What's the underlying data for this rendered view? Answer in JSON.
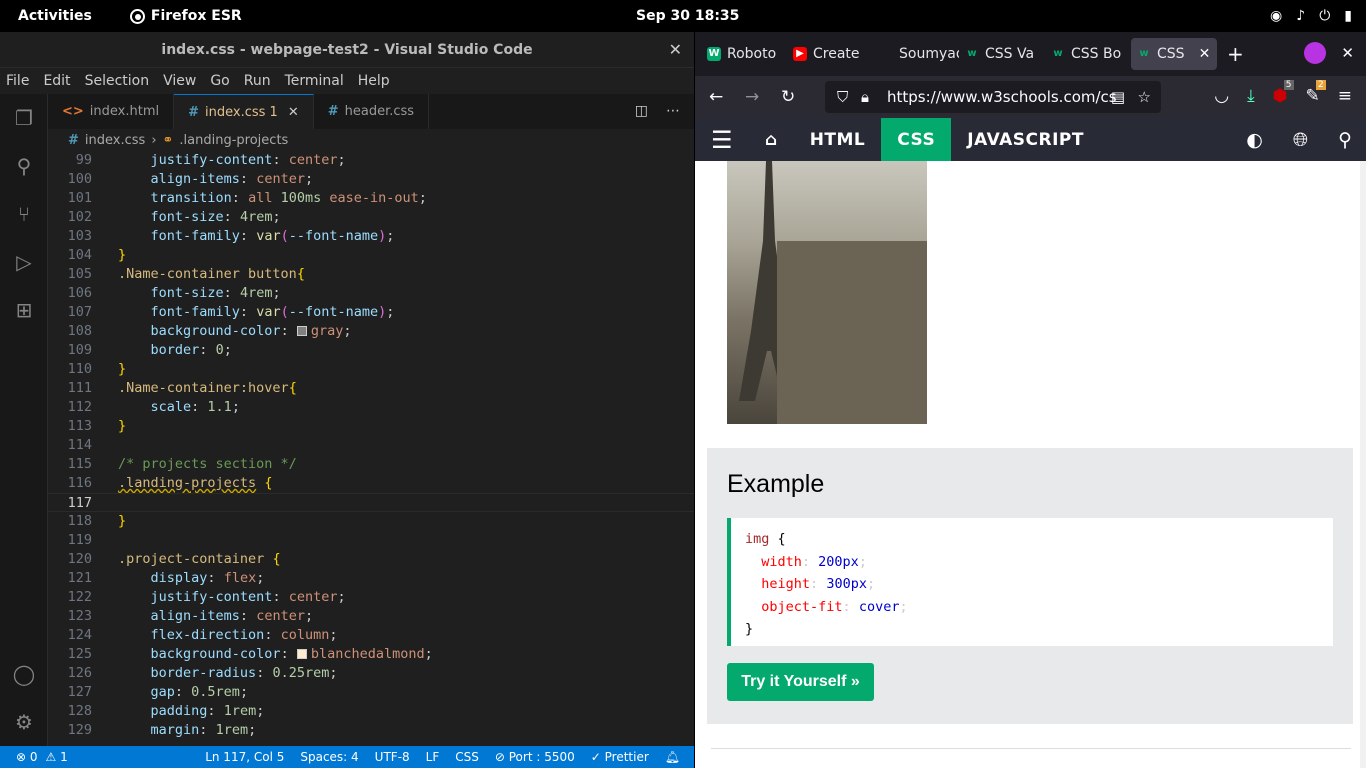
{
  "topbar": {
    "activities": "Activities",
    "app_name": "Firefox ESR",
    "clock": "Sep 30  18:35"
  },
  "vscode": {
    "title": "index.css - webpage-test2 - Visual Studio Code",
    "menu": [
      "File",
      "Edit",
      "Selection",
      "View",
      "Go",
      "Run",
      "Terminal",
      "Help"
    ],
    "tabs": [
      {
        "label": "index.html",
        "icon": "html-file-icon"
      },
      {
        "label": "index.css 1",
        "icon": "css-file-icon"
      },
      {
        "label": "header.css",
        "icon": "css-file-icon"
      }
    ],
    "breadcrumb": {
      "file": "index.css",
      "symbol": ".landing-projects"
    },
    "line_numbers": [
      "99",
      "100",
      "101",
      "102",
      "103",
      "104",
      "105",
      "106",
      "107",
      "108",
      "109",
      "110",
      "111",
      "112",
      "113",
      "114",
      "115",
      "116",
      "117",
      "118",
      "119",
      "120",
      "121",
      "122",
      "123",
      "124",
      "125",
      "126",
      "127",
      "128",
      "129"
    ],
    "code": {
      "l99_p": "justify-content",
      "l99_v": "center",
      "l100_p": "align-items",
      "l100_v": "center",
      "l101_p": "transition",
      "l101_v1": "all",
      "l101_n": "100ms",
      "l101_v2": "ease-in-out",
      "l102_p": "font-size",
      "l102_n": "4rem",
      "l103_p": "font-family",
      "l103_f": "var",
      "l103_arg": "--font-name",
      "l105_s": ".Name-container button",
      "l106_p": "font-size",
      "l106_n": "4rem",
      "l107_p": "font-family",
      "l107_f": "var",
      "l107_arg": "--font-name",
      "l108_p": "background-color",
      "l108_v": "gray",
      "l109_p": "border",
      "l109_n": "0",
      "l111_s": ".Name-container:hover",
      "l112_p": "scale",
      "l112_n": "1.1",
      "l115_c": "/* projects section */",
      "l116_s": ".landing-projects",
      "l120_s": ".project-container",
      "l121_p": "display",
      "l121_v": "flex",
      "l122_p": "justify-content",
      "l122_v": "center",
      "l123_p": "align-items",
      "l123_v": "center",
      "l124_p": "flex-direction",
      "l124_v": "column",
      "l125_p": "background-color",
      "l125_v": "blanchedalmond",
      "l126_p": "border-radius",
      "l126_n": "0.25rem",
      "l127_p": "gap",
      "l127_n": "0.5rem",
      "l128_p": "padding",
      "l128_n": "1rem",
      "l129_p": "margin",
      "l129_n": "1rem"
    },
    "status": {
      "errors": "⊗ 0",
      "warnings": "⚠ 1",
      "position": "Ln 117, Col 5",
      "spaces": "Spaces: 4",
      "encoding": "UTF-8",
      "eol": "LF",
      "language": "CSS",
      "port": "⊘ Port : 5500",
      "prettier": "✓ Prettier"
    },
    "colors": {
      "gray": "#808080",
      "blanchedalmond": "#ffebcd",
      "accent": "#0078d4"
    }
  },
  "firefox": {
    "tabs": [
      {
        "label": "Roboto",
        "favicon": "W3",
        "color": "#04aa6d"
      },
      {
        "label": "Create",
        "favicon": "▶",
        "color": "#ff0000"
      },
      {
        "label": "Soumyade",
        "favicon": "",
        "color": "#1c1b22"
      },
      {
        "label": "CSS Va",
        "favicon": "w",
        "color": "#04aa6d"
      },
      {
        "label": "CSS Bo",
        "favicon": "w",
        "color": "#04aa6d"
      },
      {
        "label": "CSS",
        "favicon": "w",
        "color": "#04aa6d"
      }
    ],
    "url": "https://www.w3schools.com/cs",
    "badges": {
      "ublock": "5",
      "ext": "2"
    }
  },
  "w3": {
    "nav": [
      "HTML",
      "CSS",
      "JAVASCRIPT"
    ],
    "example_heading": "Example",
    "code": {
      "selector": "img",
      "open": "{",
      "p1": "width",
      "v1": "200px",
      "p2": "height",
      "v2": "300px",
      "p3": "object-fit",
      "v3": "cover",
      "close": "}"
    },
    "try_button": "Try it Yourself »",
    "accent": "#04aa6d"
  }
}
